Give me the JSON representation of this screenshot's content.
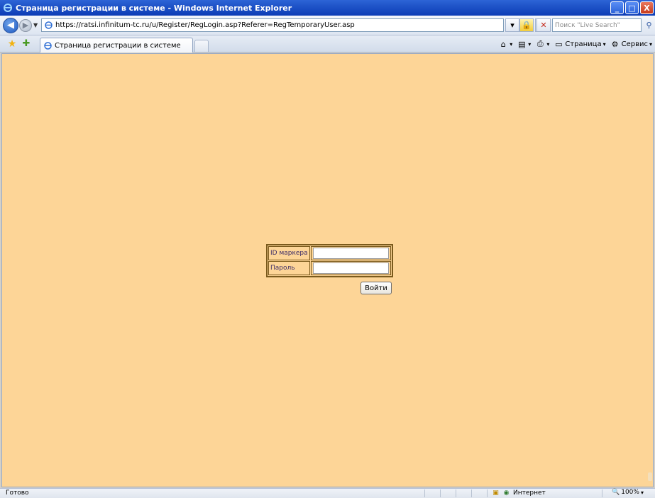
{
  "window": {
    "title": "Страница регистрации в системе - Windows Internet Explorer",
    "minimize": "_",
    "maximize": "□",
    "close": "X"
  },
  "address_bar": {
    "url": "https://ratsi.infinitum-tc.ru/u/Register/RegLogin.asp?Referer=RegTemporaryUser.asp",
    "search_placeholder": "Поиск \"Live Search\""
  },
  "tab": {
    "title": "Страница регистрации в системе"
  },
  "command_bar": {
    "page_label": "Страница",
    "tools_label": "Сервис"
  },
  "login": {
    "id_label": "ID маркера",
    "password_label": "Пароль",
    "id_value": "",
    "password_value": "",
    "submit_label": "Войти"
  },
  "status_bar": {
    "status_text": "Готово",
    "zone_text": "Интернет",
    "zoom_text": "100%"
  },
  "colors": {
    "page_background": "#fdd597",
    "form_border": "#7a5a1c",
    "label_text": "#3b2b66"
  }
}
